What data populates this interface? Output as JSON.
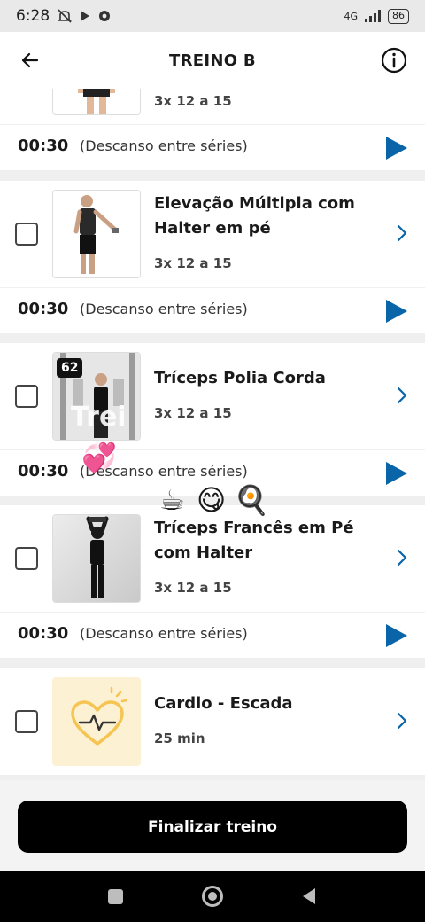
{
  "status_bar": {
    "time": "6:28",
    "network": "4G",
    "battery": "86"
  },
  "header": {
    "title": "TREINO B",
    "back_icon": "arrow-left-icon",
    "info_icon": "info-icon"
  },
  "exercises": [
    {
      "name": "",
      "reps": "3x 12 a 15",
      "visible_partial": true
    },
    {
      "name": "Elevação Múltipla com Halter em pé",
      "reps": "3x 12 a 15"
    },
    {
      "name": "Tríceps Polia Corda",
      "reps": "3x 12 a 15",
      "badge": "62"
    },
    {
      "name": "Tríceps Francês em Pé com Halter",
      "reps": "3x 12 a 15"
    },
    {
      "name": "Cardio - Escada",
      "reps": "25 min"
    }
  ],
  "rest_rows": [
    {
      "time": "00:30",
      "label": "(Descanso entre séries)"
    },
    {
      "time": "00:30",
      "label": "(Descanso entre séries)"
    },
    {
      "time": "00:30",
      "label": "(Descanso entre séries)"
    },
    {
      "time": "00:30",
      "label": "(Descanso entre séries)"
    }
  ],
  "footer": {
    "finish_label": "Finalizar treino"
  },
  "overlay": {
    "watermark_text": "Trei",
    "emojis": [
      "💞",
      "☕",
      "😋",
      "🍳"
    ]
  },
  "colors": {
    "accent_play": "#0a64a8",
    "chevron": "#0a64a8",
    "cardio_thumb_bg": "#fdf1d3",
    "cardio_heart": "#f5c453",
    "button_bg": "#000000"
  }
}
